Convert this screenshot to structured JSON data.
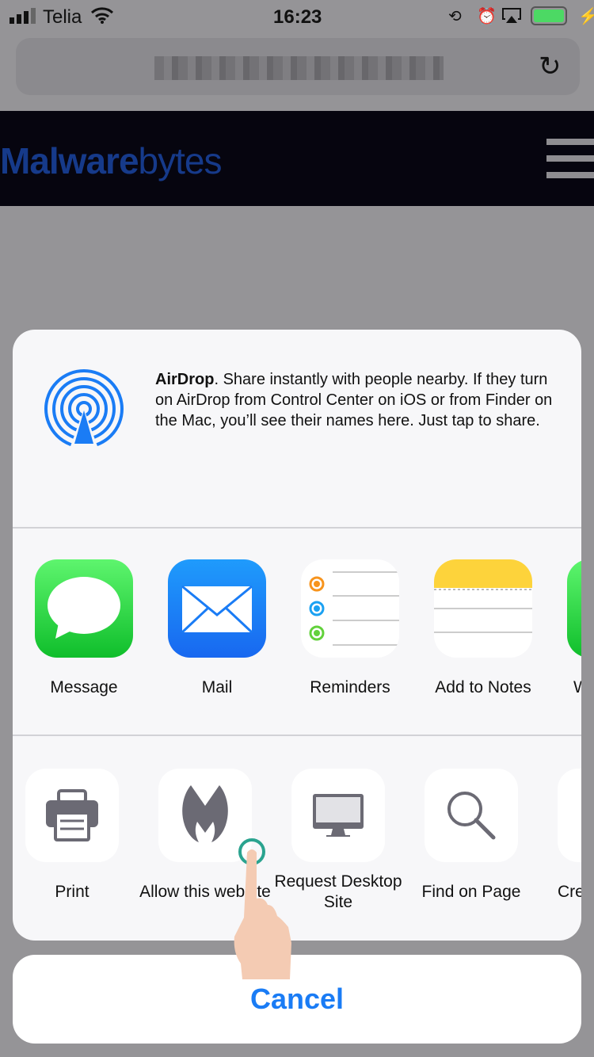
{
  "status_bar": {
    "carrier": "Telia",
    "time": "16:23",
    "battery_color": "#4cd964"
  },
  "browser": {
    "reload_icon": "reload-icon"
  },
  "site": {
    "logo_part1": "Malware",
    "logo_part2": "bytes"
  },
  "share_sheet": {
    "airdrop": {
      "title": "AirDrop",
      "text": ". Share instantly with people nearby. If they turn on AirDrop from Control Center on iOS or from Finder on the Mac, you’ll see their names here. Just tap to share."
    },
    "apps": [
      {
        "label": "Message"
      },
      {
        "label": "Mail"
      },
      {
        "label": "Reminders"
      },
      {
        "label": "Add to Notes"
      },
      {
        "label": "W"
      }
    ],
    "actions": [
      {
        "label": "Print"
      },
      {
        "label": "Allow this website"
      },
      {
        "label": "Request Desktop Site"
      },
      {
        "label": "Find on Page"
      },
      {
        "label": "Cre"
      }
    ],
    "cancel_label": "Cancel"
  },
  "accent_color": "#1a7cf5"
}
